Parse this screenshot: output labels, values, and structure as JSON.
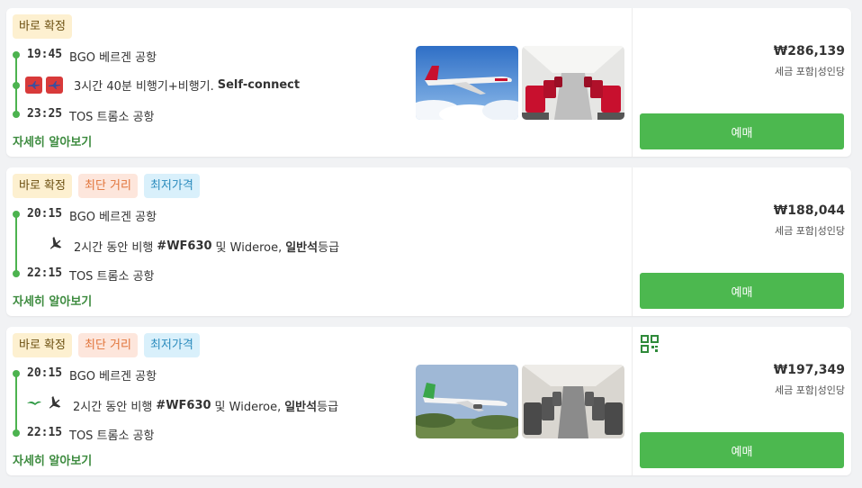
{
  "results": [
    {
      "badges": [
        "바로 확정"
      ],
      "depart_time": "19:45",
      "depart_place": "BGO 베르겐 공항",
      "duration_text": "3시간 40분 비행기+비행기.",
      "connect_text": "Self-connect",
      "arrive_time": "23:25",
      "arrive_place": "TOS 트롬소 공항",
      "detail_link": "자세히 알아보기",
      "price": "₩286,139",
      "tax_note": "세금 포함|성인당",
      "buy_label": "예매"
    },
    {
      "badges": [
        "바로 확정",
        "최단 거리",
        "최저가격"
      ],
      "depart_time": "20:15",
      "depart_place": "BGO 베르겐 공항",
      "duration_text": "2시간 동안 비행",
      "flight_no": "#WF630",
      "and_text": "및 Wideroe,",
      "cabin": "일반석",
      "cabin_suffix": "등급",
      "arrive_time": "22:15",
      "arrive_place": "TOS 트롬소 공항",
      "detail_link": "자세히 알아보기",
      "price": "₩188,044",
      "tax_note": "세금 포함|성인당",
      "buy_label": "예매"
    },
    {
      "badges": [
        "바로 확정",
        "최단 거리",
        "최저가격"
      ],
      "depart_time": "20:15",
      "depart_place": "BGO 베르겐 공항",
      "duration_text": "2시간 동안 비행",
      "flight_no": "#WF630",
      "and_text": "및 Wideroe,",
      "cabin": "일반석",
      "cabin_suffix": "등급",
      "arrive_time": "22:15",
      "arrive_place": "TOS 트롬소 공항",
      "detail_link": "자세히 알아보기",
      "price": "₩197,349",
      "tax_note": "세금 포함|성인당",
      "buy_label": "예매"
    }
  ],
  "colors": {
    "accent": "#4cb84f",
    "confirm_bg": "#fdf0d0",
    "short_bg": "#fde6dc",
    "cheap_bg": "#d9f0fb"
  }
}
